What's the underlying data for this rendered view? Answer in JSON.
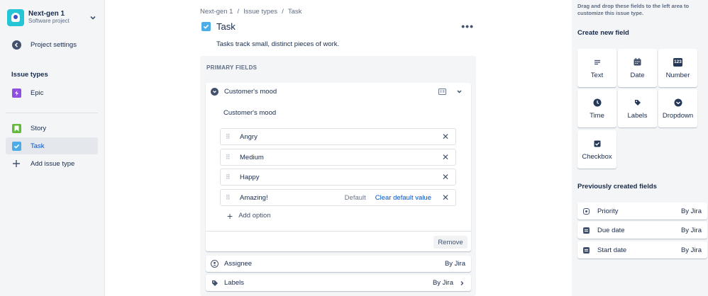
{
  "sidebar": {
    "project_name": "Next-gen 1",
    "project_type": "Software project",
    "project_settings": "Project settings",
    "issue_types_heading": "Issue types",
    "items": [
      {
        "label": "Epic",
        "color": "#904EE2"
      },
      {
        "label": "Story",
        "color": "#63BA3C"
      },
      {
        "label": "Task",
        "color": "#4BADE8"
      }
    ],
    "add_issue_type": "Add issue type"
  },
  "breadcrumb": {
    "items": [
      "Next-gen 1",
      "/",
      "Issue types",
      "/",
      "Task"
    ]
  },
  "issue_type": {
    "title": "Task",
    "description": "Tasks track small, distinct pieces of work.",
    "more_label": "•••"
  },
  "primary_fields": {
    "heading": "PRIMARY FIELDS",
    "dropdown_field": {
      "label": "Customer's mood",
      "name": "Customer's mood",
      "options": [
        {
          "label": "Angry"
        },
        {
          "label": "Medium"
        },
        {
          "label": "Happy"
        },
        {
          "label": "Amazing!",
          "default": "Default",
          "clear": "Clear default value"
        }
      ],
      "add_option": "Add option",
      "remove": "Remove"
    },
    "assignee": {
      "label": "Assignee",
      "by": "By Jira"
    },
    "labels": {
      "label": "Labels",
      "by": "By Jira"
    }
  },
  "right_panel": {
    "hint": "Drag and drop these fields to the left area to customize this issue type.",
    "create_heading": "Create new field",
    "tiles": [
      "Text",
      "Date",
      "Number",
      "Time",
      "Labels",
      "Dropdown",
      "Checkbox"
    ],
    "number_icon_text": "123",
    "previous_heading": "Previously created fields",
    "previous": [
      {
        "label": "Priority",
        "by": "By Jira"
      },
      {
        "label": "Due date",
        "by": "By Jira"
      },
      {
        "label": "Start date",
        "by": "By Jira"
      }
    ]
  },
  "colors": {
    "accent": "#0052CC",
    "text": "#172B4D",
    "sidebar_bg": "#F4F5F7"
  }
}
